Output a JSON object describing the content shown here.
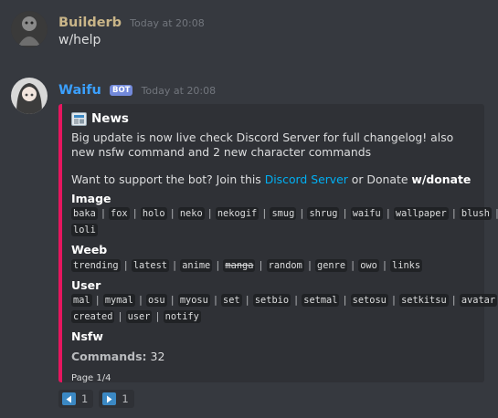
{
  "messages": [
    {
      "author": "Builderb",
      "timestamp": "Today at 20:08",
      "text": "w/help",
      "author_color": "#c9b588"
    },
    {
      "author": "Waifu",
      "tag": "BOT",
      "timestamp": "Today at 20:08",
      "author_color": "#3ba0ff"
    }
  ],
  "embed": {
    "accent_color": "#e7165f",
    "title": "News",
    "description_line1": "Big update is now live check Discord Server for full changelog! also new nsfw command and 2 new character commands",
    "support_prefix": "Want to support the bot? Join this ",
    "support_link": "Discord Server",
    "support_middle": " or Donate ",
    "support_cmd": "w/donate",
    "fields": {
      "image": {
        "name": "Image",
        "commands": [
          "baka",
          "fox",
          "holo",
          "neko",
          "nekogif",
          "smug",
          "shrug",
          "waifu",
          "wallpaper",
          "blush",
          "loli"
        ]
      },
      "weeb": {
        "name": "Weeb",
        "commands": [
          "trending",
          "latest",
          "anime",
          "manga",
          "random",
          "genre",
          "owo",
          "links"
        ]
      },
      "user": {
        "name": "User",
        "commands": [
          "mal",
          "mymal",
          "osu",
          "myosu",
          "set",
          "setbio",
          "setmal",
          "setosu",
          "setkitsu",
          "avatar",
          "created",
          "user",
          "notify"
        ]
      },
      "nsfw": {
        "name": "Nsfw"
      }
    },
    "commands_label": "Commands:",
    "commands_count": "32",
    "footer": "Page 1/4"
  },
  "reactions": [
    {
      "icon": "arrow-left-icon",
      "count": "1"
    },
    {
      "icon": "arrow-right-icon",
      "count": "1"
    }
  ]
}
